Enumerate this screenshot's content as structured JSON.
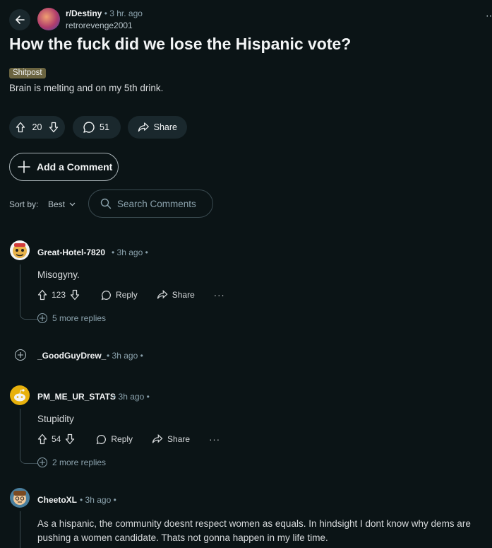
{
  "post": {
    "subreddit": "r/Destiny",
    "time": "3 hr. ago",
    "author": "retrorevenge2001",
    "title": "How the fuck did we lose the Hispanic vote?",
    "flair": "Shitpost",
    "body": "Brain is melting and on my 5th drink.",
    "votes": "20",
    "comments": "51",
    "share_label": "Share"
  },
  "add_comment_label": "Add a Comment",
  "sort": {
    "label": "Sort by:",
    "value": "Best"
  },
  "search": {
    "placeholder": "Search Comments"
  },
  "comments": [
    {
      "user": "Great-Hotel-7820",
      "time": "3h ago",
      "text": "Misogyny.",
      "votes": "123",
      "reply": "Reply",
      "share": "Share",
      "more_replies": "5 more replies"
    },
    {
      "user": "_GoodGuyDrew_",
      "time": "3h ago",
      "collapsed": true
    },
    {
      "user": "PM_ME_UR_STATS",
      "time": "3h ago",
      "text": "Stupidity",
      "votes": "54",
      "reply": "Reply",
      "share": "Share",
      "more_replies": "2 more replies"
    },
    {
      "user": "CheetoXL",
      "time": "3h ago",
      "text": "As a hispanic, the community doesnt respect women as equals. In hindsight I dont know why dems are pushing a women candidate. Thats not gonna happen in my life time."
    }
  ],
  "icons": {
    "back": "arrow-left-icon",
    "upvote": "arrow-up-icon",
    "downvote": "arrow-down-icon",
    "comment": "speech-bubble-icon",
    "share": "share-arrow-icon",
    "add": "plus-icon",
    "search": "magnifier-icon",
    "more": "ellipsis-icon",
    "expand": "circle-plus-icon"
  },
  "colors": {
    "background": "#0b1416",
    "pill": "#1a282d",
    "flair": "#6b6440",
    "muted": "#8ba2ad"
  }
}
